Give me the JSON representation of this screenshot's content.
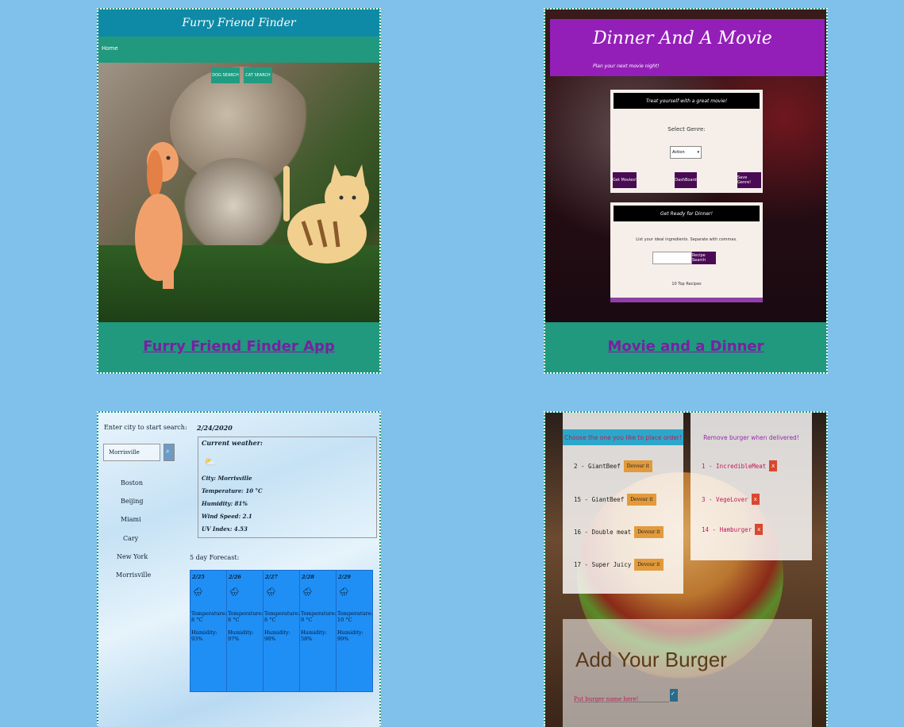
{
  "colors": {
    "page_bg": "#7fc1ea",
    "card_footer": "#20997f",
    "link": "#7b1fa2"
  },
  "projects": [
    {
      "caption": "Furry Friend Finder App",
      "screenshot": {
        "title": "Furry Friend Finder",
        "nav_home": "Home",
        "btn_dog": "DOG SEARCH",
        "btn_cat": "CAT SEARCH"
      }
    },
    {
      "caption": "Movie and a Dinner",
      "screenshot": {
        "title": "Dinner And A Movie",
        "subtitle": "Plan your next movie night!",
        "movie_panel_title": "Treat yourself with a great movie!",
        "select_genre": "Select Genre:",
        "genre_value": "Action",
        "btn_get_movies": "Get Movies!",
        "btn_dashboard": "DashBoard",
        "btn_save_genre": "Save Genre!",
        "dinner_panel_title": "Get Ready for Dinner!",
        "ingredients_hint": "List your ideal ingredients. Separate with commas.",
        "btn_recipe_search": "Recipe Search",
        "top_recipes": "10 Top Recipes"
      }
    },
    {
      "caption": "",
      "screenshot": {
        "search_label": "Enter city to start search:",
        "search_value": "Morrisville",
        "cities": [
          "Boston",
          "Beijing",
          "Miami",
          "Cary",
          "New York",
          "Morrisville"
        ],
        "date": "2/24/2020",
        "current_weather": "Current weather:",
        "city_line": "City: Morrisville",
        "temp_line": "Temperature: 10 °C",
        "humidity_line": "Humidity: 81%",
        "wind_line": "Wind Speed: 2.1",
        "uv_line": "UV Index: 4.53",
        "forecast_label": "5 day Forecast:",
        "forecast": [
          {
            "date": "2/25",
            "temp": "Temperature: 8 °C",
            "humidity": "Humidity: 93%"
          },
          {
            "date": "2/26",
            "temp": "Temperature: 8 °C",
            "humidity": "Humidity: 97%"
          },
          {
            "date": "2/27",
            "temp": "Temperature: 8 °C",
            "humidity": "Humidity: 98%"
          },
          {
            "date": "2/28",
            "temp": "Temperature: 9 °C",
            "humidity": "Humidity: 58%"
          },
          {
            "date": "2/29",
            "temp": "Temperature: 10 °C",
            "humidity": "Humidity: 99%"
          }
        ]
      }
    },
    {
      "caption": "",
      "screenshot": {
        "order_title": "Choose the one you like to place order!",
        "deliver_title": "Remove burger when delivered!",
        "order_items": [
          "2 - GiantBeef",
          "15 - GiantBeef",
          "16 - Double meat",
          "17 - Super Juicy"
        ],
        "devour_label": "Devour it",
        "delivered_items": [
          "1 - IncredibleMeat",
          "3 - VegeLover",
          "14 - Hamburger"
        ],
        "remove_label": "x",
        "add_title": "Add Your Burger",
        "add_placeholder": "Put burger name here!"
      }
    }
  ]
}
